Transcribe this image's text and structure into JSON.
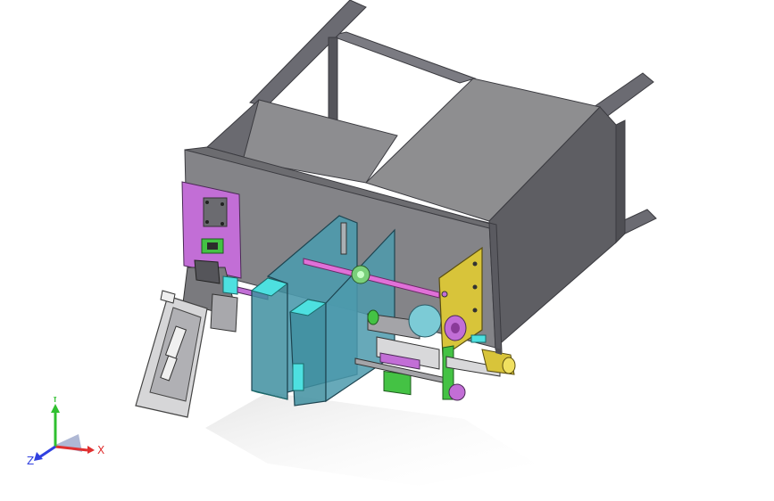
{
  "viewport": {
    "background": "#ffffff",
    "model": {
      "frame_color": "#6b6b72",
      "panel_color": "#8a8a8c",
      "panel_dark": "#5e5e63",
      "magenta_plate": "#c26ed6",
      "blue_plate": "#3f8fa0",
      "cyan": "#4de0e0",
      "yellow_plate": "#d8c43a",
      "green": "#44c244",
      "rod_color": "#e070d8"
    }
  },
  "triad": {
    "x_label": "X",
    "y_label": "Y",
    "z_label": "Z",
    "x_color": "#e03030",
    "y_color": "#30c030",
    "z_color": "#3040e0"
  }
}
